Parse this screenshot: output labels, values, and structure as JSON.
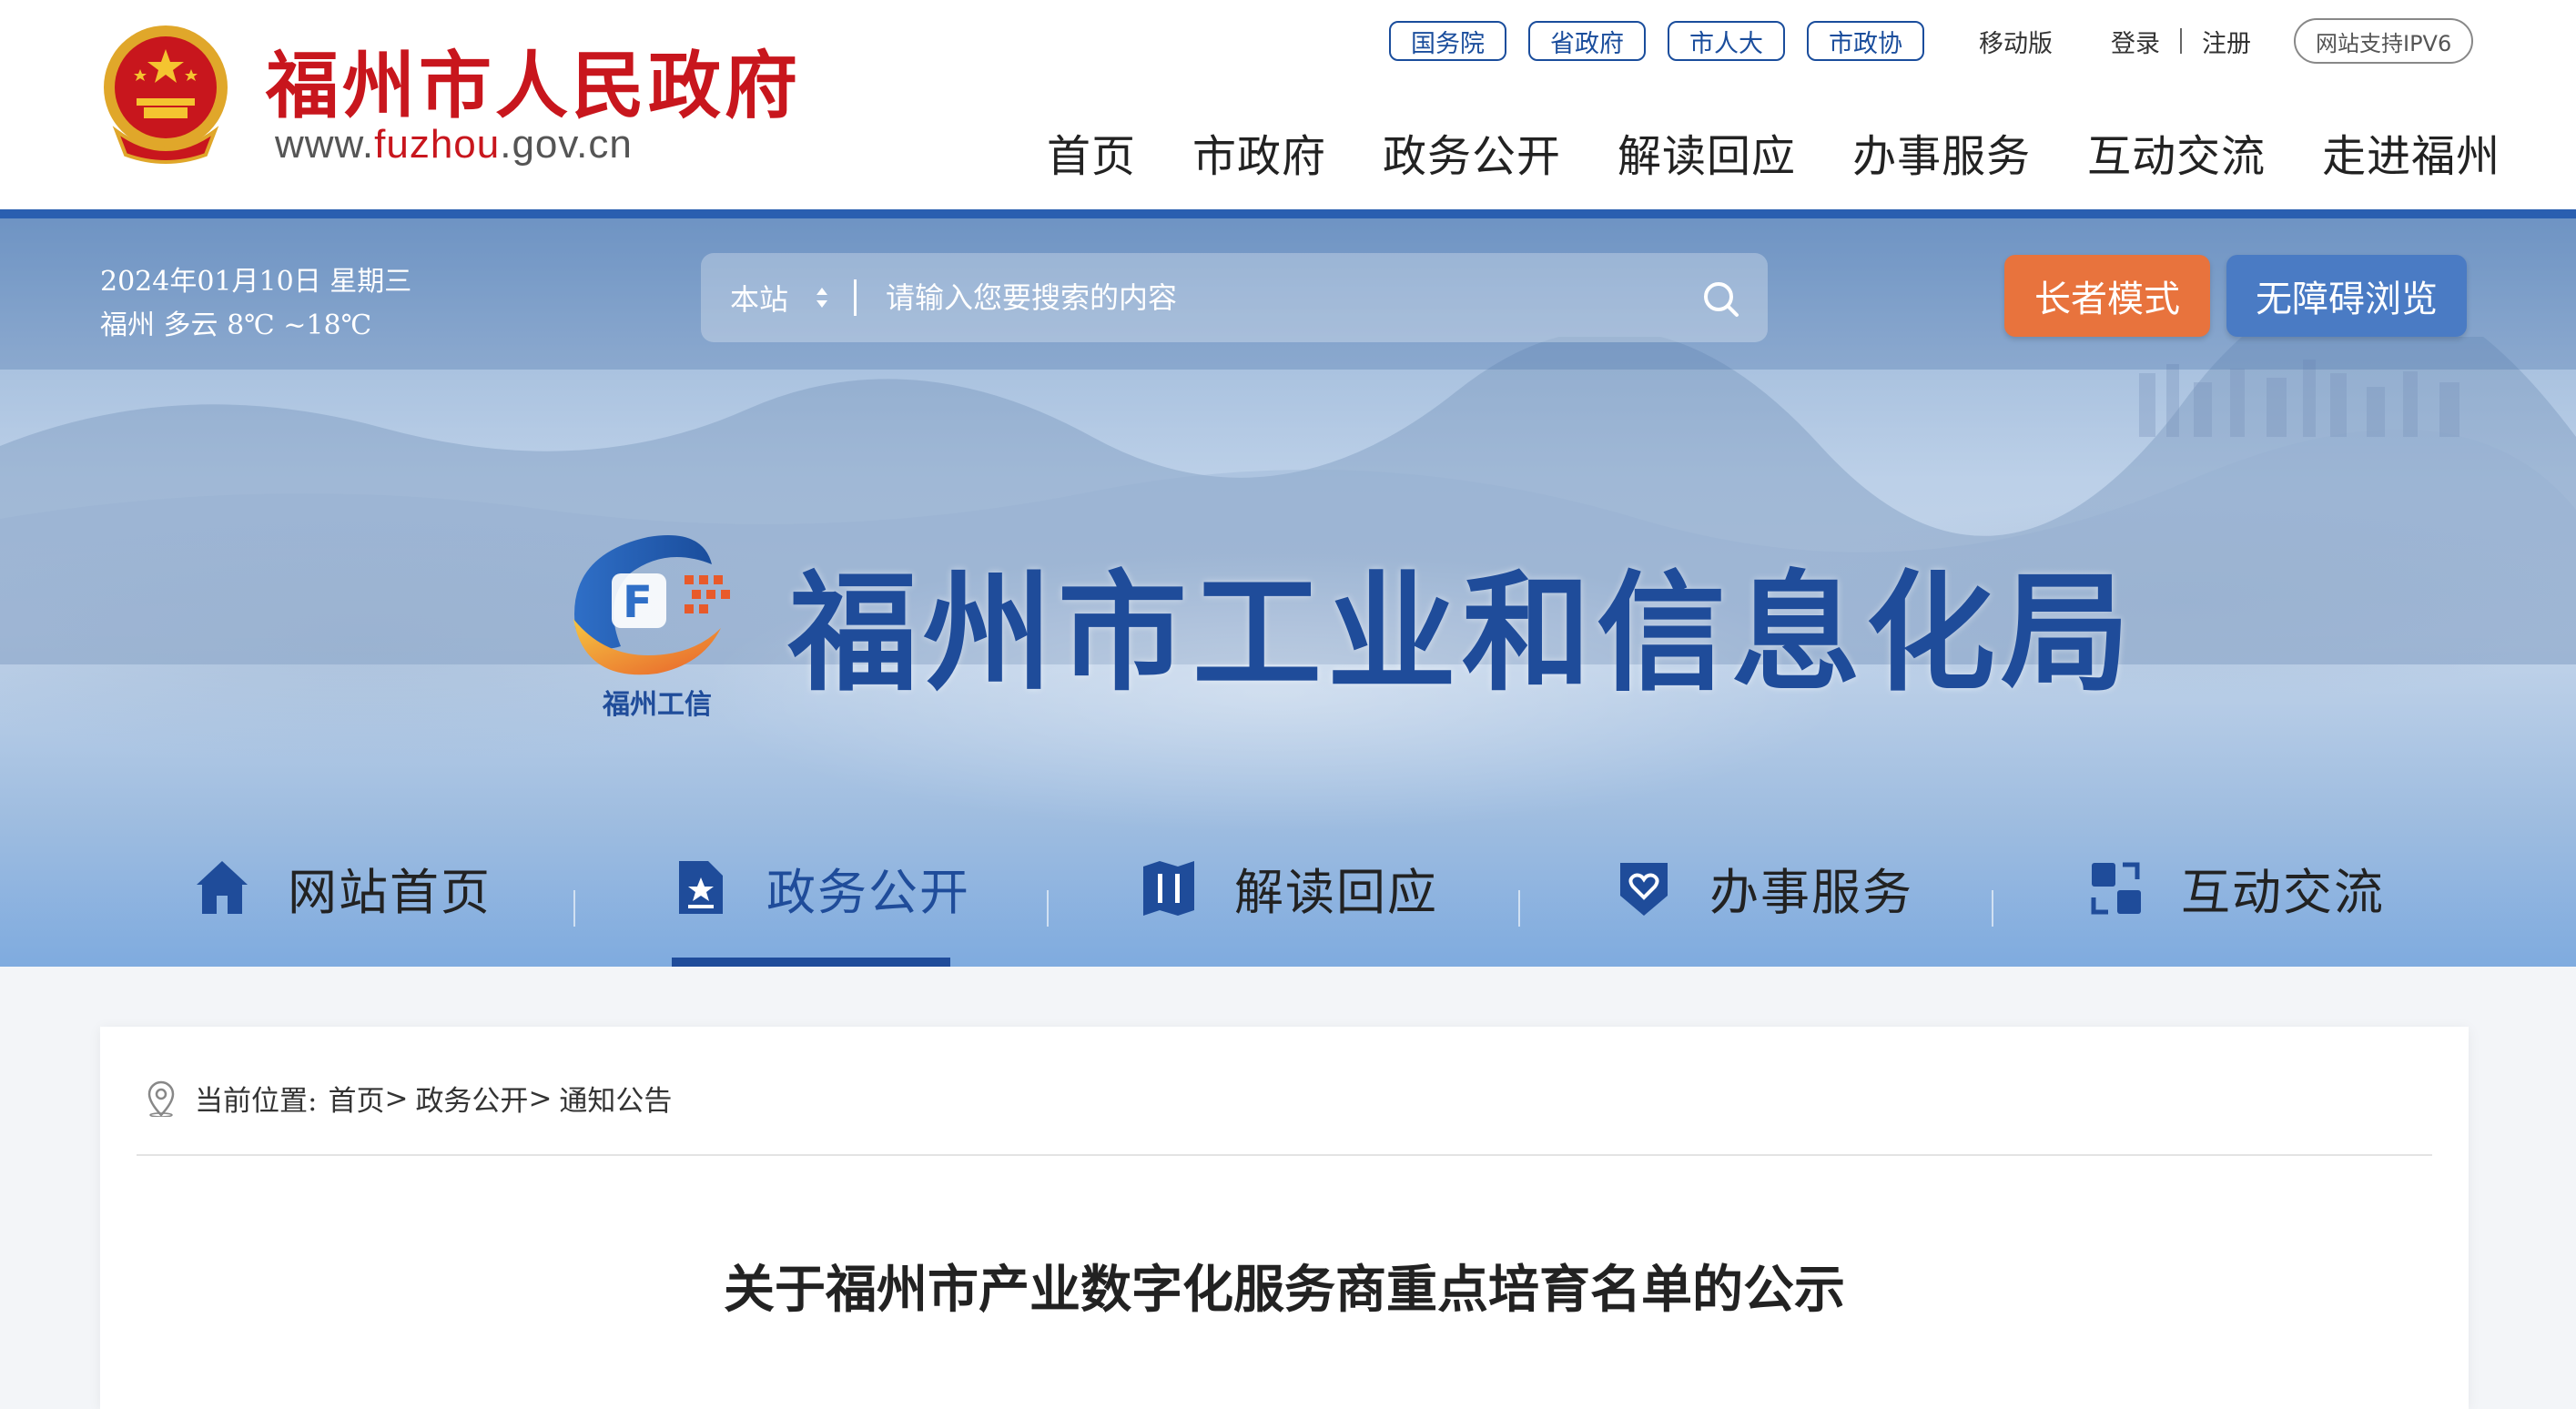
{
  "header": {
    "site_title": "福州市人民政府",
    "site_url_prefix": "www.",
    "site_url_accent": "fuzhou",
    "site_url_suffix": ".gov.cn",
    "top_links": [
      "国务院",
      "省政府",
      "市人大",
      "市政协"
    ],
    "mobile_label": "移动版",
    "login_label": "登录",
    "register_label": "注册",
    "ipv6_label": "网站支持IPV6",
    "nav": [
      "首页",
      "市政府",
      "政务公开",
      "解读回应",
      "办事服务",
      "互动交流",
      "走进福州"
    ]
  },
  "banner": {
    "date": "2024年01月10日 星期三",
    "weather": "福州 多云 8℃ ~18℃",
    "search": {
      "scope": "本站",
      "placeholder": "请输入您要搜索的内容"
    },
    "elder_mode_label": "长者模式",
    "accessibility_label": "无障碍浏览",
    "logo_caption": "福州工信",
    "bureau_title": "福州市工业和信息化局",
    "sub_nav": [
      {
        "label": "网站首页",
        "icon": "home-icon",
        "active": false
      },
      {
        "label": "政务公开",
        "icon": "document-star-icon",
        "active": true
      },
      {
        "label": "解读回应",
        "icon": "map-book-icon",
        "active": false
      },
      {
        "label": "办事服务",
        "icon": "heart-shield-icon",
        "active": false
      },
      {
        "label": "互动交流",
        "icon": "exchange-icon",
        "active": false
      }
    ]
  },
  "content": {
    "breadcrumb_prefix": "当前位置:",
    "breadcrumb": [
      "首页",
      "政务公开",
      "通知公告"
    ],
    "breadcrumb_sep": ">",
    "title": "关于福州市产业数字化服务商重点培育名单的公示"
  },
  "colors": {
    "brand_red": "#c8161d",
    "brand_blue": "#1f4c9a",
    "elder_orange": "#e8733d",
    "access_blue": "#4a7bc4"
  }
}
